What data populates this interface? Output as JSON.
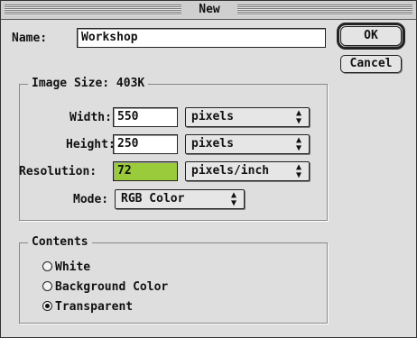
{
  "window": {
    "title": "New"
  },
  "name_field": {
    "label": "Name:",
    "value": "Workshop"
  },
  "image_size": {
    "label": "Image Size: 403K"
  },
  "width": {
    "label": "Width:",
    "value": "550",
    "unit": "pixels"
  },
  "height": {
    "label": "Height:",
    "value": "250",
    "unit": "pixels"
  },
  "resolution": {
    "label": "Resolution:",
    "value": "72",
    "unit": "pixels/inch"
  },
  "mode": {
    "label": "Mode:",
    "value": "RGB Color"
  },
  "buttons": {
    "ok": "OK",
    "cancel": "Cancel"
  },
  "contents": {
    "label": "Contents",
    "options": [
      "White",
      "Background Color",
      "Transparent"
    ],
    "selected": "Transparent"
  },
  "colors": {
    "resolution_highlight": "#9acb3a"
  },
  "icons": {
    "popup_arrows": "up-down-arrows-icon"
  }
}
